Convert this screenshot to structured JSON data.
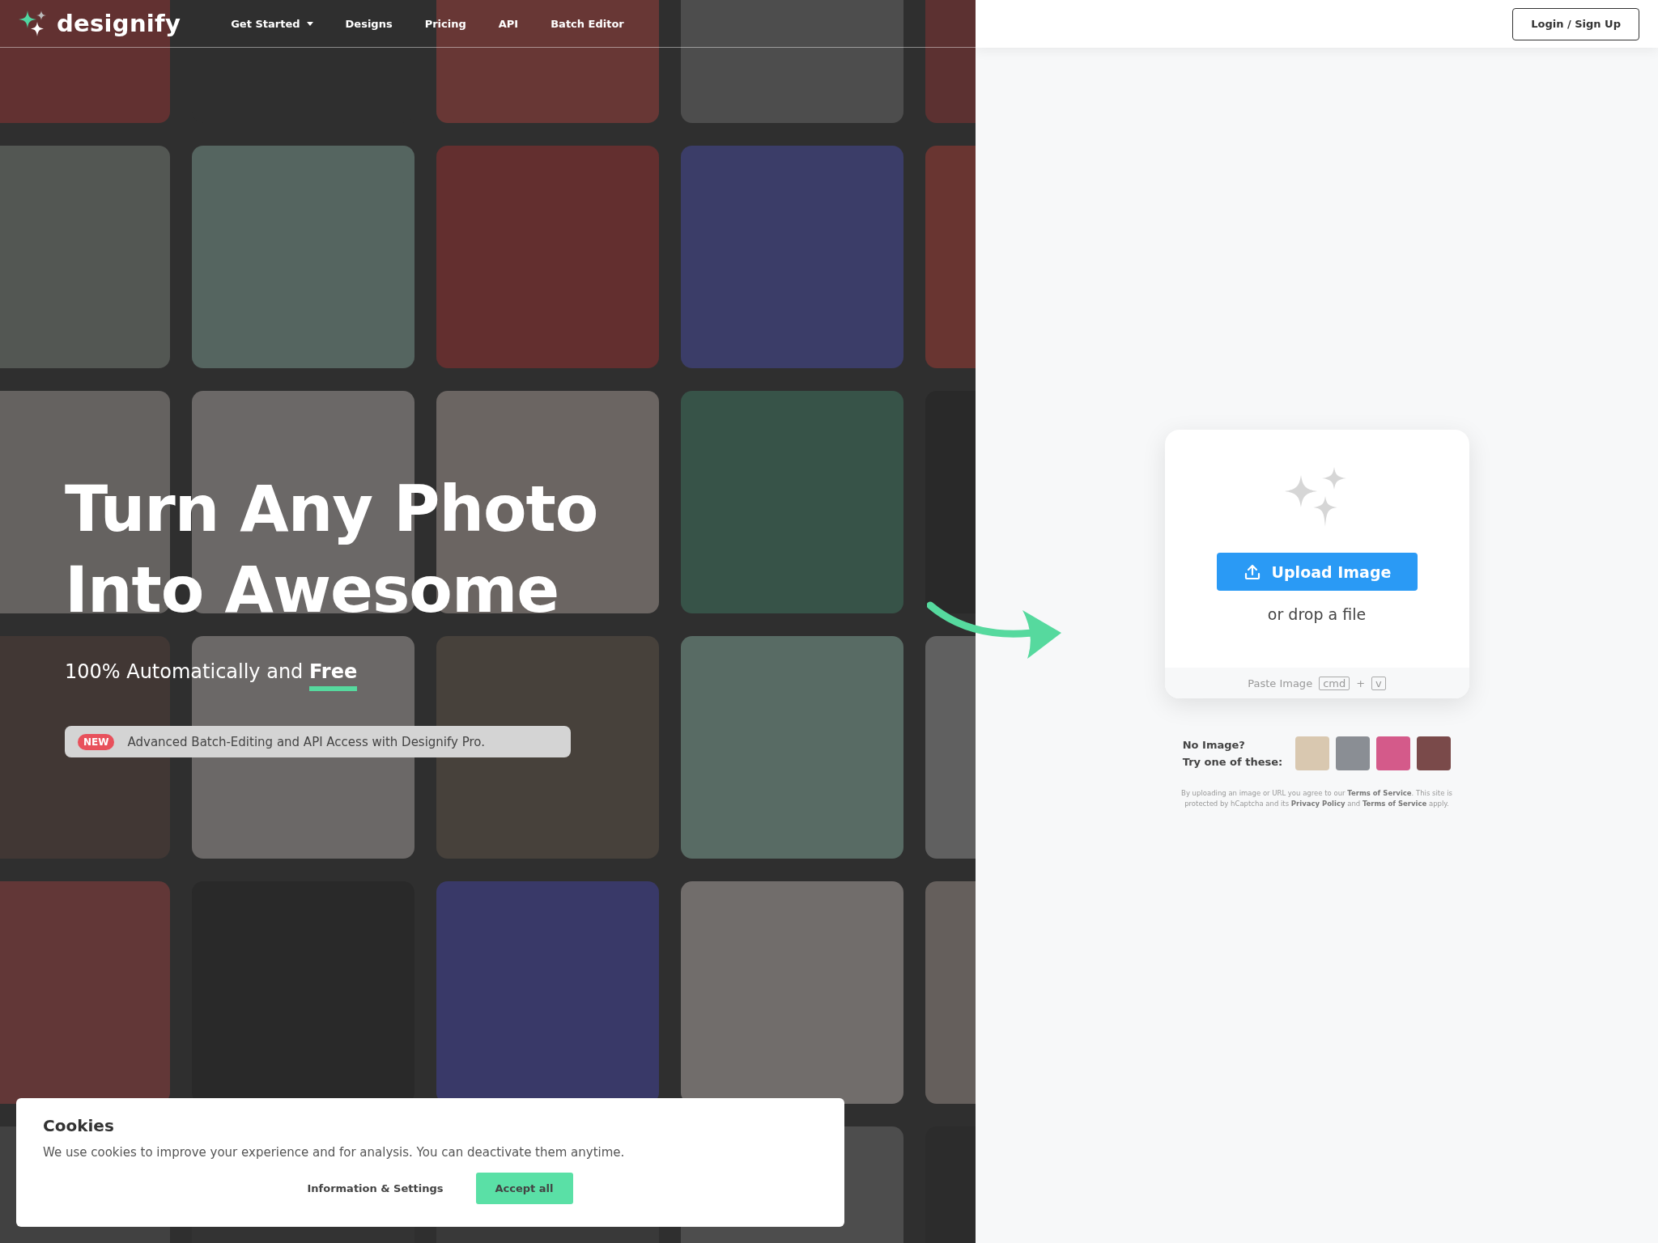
{
  "header": {
    "logo_text": "designify",
    "nav": [
      {
        "label": "Get Started",
        "dropdown": true
      },
      {
        "label": "Designs",
        "dropdown": false
      },
      {
        "label": "Pricing",
        "dropdown": false
      },
      {
        "label": "API",
        "dropdown": false
      },
      {
        "label": "Batch Editor",
        "dropdown": false
      }
    ],
    "login_button": "Login / Sign Up"
  },
  "hero": {
    "title_lines": [
      "Turn Any Photo",
      "Into Awesome"
    ],
    "subtitle": "100% Automatically and **Free**",
    "banner": {
      "badge": "NEW",
      "text": "Advanced Batch-Editing and API Access with Designify Pro."
    }
  },
  "upload_card": {
    "button": "Upload Image",
    "drop_text": "or drop a file",
    "paste": {
      "label": "Paste Image",
      "keys": [
        "cmd",
        "v"
      ],
      "joiner": "+"
    }
  },
  "samples": {
    "label_lines": [
      "No Image?",
      "Try one of these:"
    ]
  },
  "legal": "By uploading an image or URL you agree to our **Terms of Service**. This site is protected by hCaptcha and its **Privacy Policy** and **Terms of Service** apply.",
  "cookies": {
    "title": "Cookies",
    "text": "We use cookies to improve your experience and for analysis. You can deactivate them anytime.",
    "buttons": [
      {
        "label": "Information & Settings",
        "kind": "link"
      },
      {
        "label": "Accept all",
        "kind": "primary"
      }
    ]
  }
}
